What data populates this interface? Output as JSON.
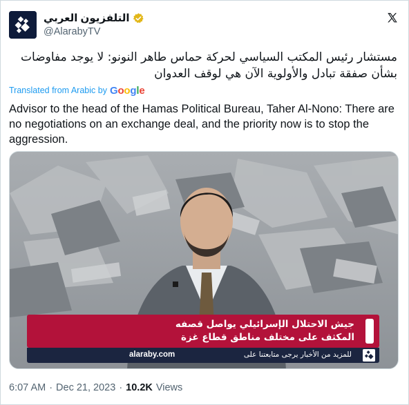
{
  "account": {
    "display_name": "التلفزيون العربي",
    "handle": "@AlarabyTV",
    "verified_color": "#e2b719"
  },
  "tweet": {
    "arabic_text": "مستشار رئيس المكتب السياسي لحركة حماس طاهر النونو: لا يوجد مفاوضات بشأن صفقة تبادل والأولوية الآن هي لوقف العدوان",
    "translated_label": "Translated from Arabic by",
    "translator": "Google",
    "translated_text": "Advisor to the head of the Hamas Political Bureau, Taher Al-Nono: There are no negotiations on an exchange deal, and the priority now is to stop the aggression."
  },
  "media": {
    "ticker_line_1": "جيش الاحتلال الإسرائيلي يواصل قصفه",
    "ticker_line_2": "المكثف على مختلف مناطق قطاع غزة",
    "site_url": "alaraby.com",
    "lower_text": "للمزيد من الأخبار يرجى متابعتنا على",
    "ticker_color": "#b3123a"
  },
  "meta": {
    "time": "6:07 AM",
    "separator": "·",
    "date": "Dec 21, 2023",
    "views_count": "10.2K",
    "views_label": "Views"
  },
  "icons": {
    "avatar": "alaraby-logo-icon",
    "verified": "verified-badge-icon",
    "platform": "x-logo-icon"
  }
}
